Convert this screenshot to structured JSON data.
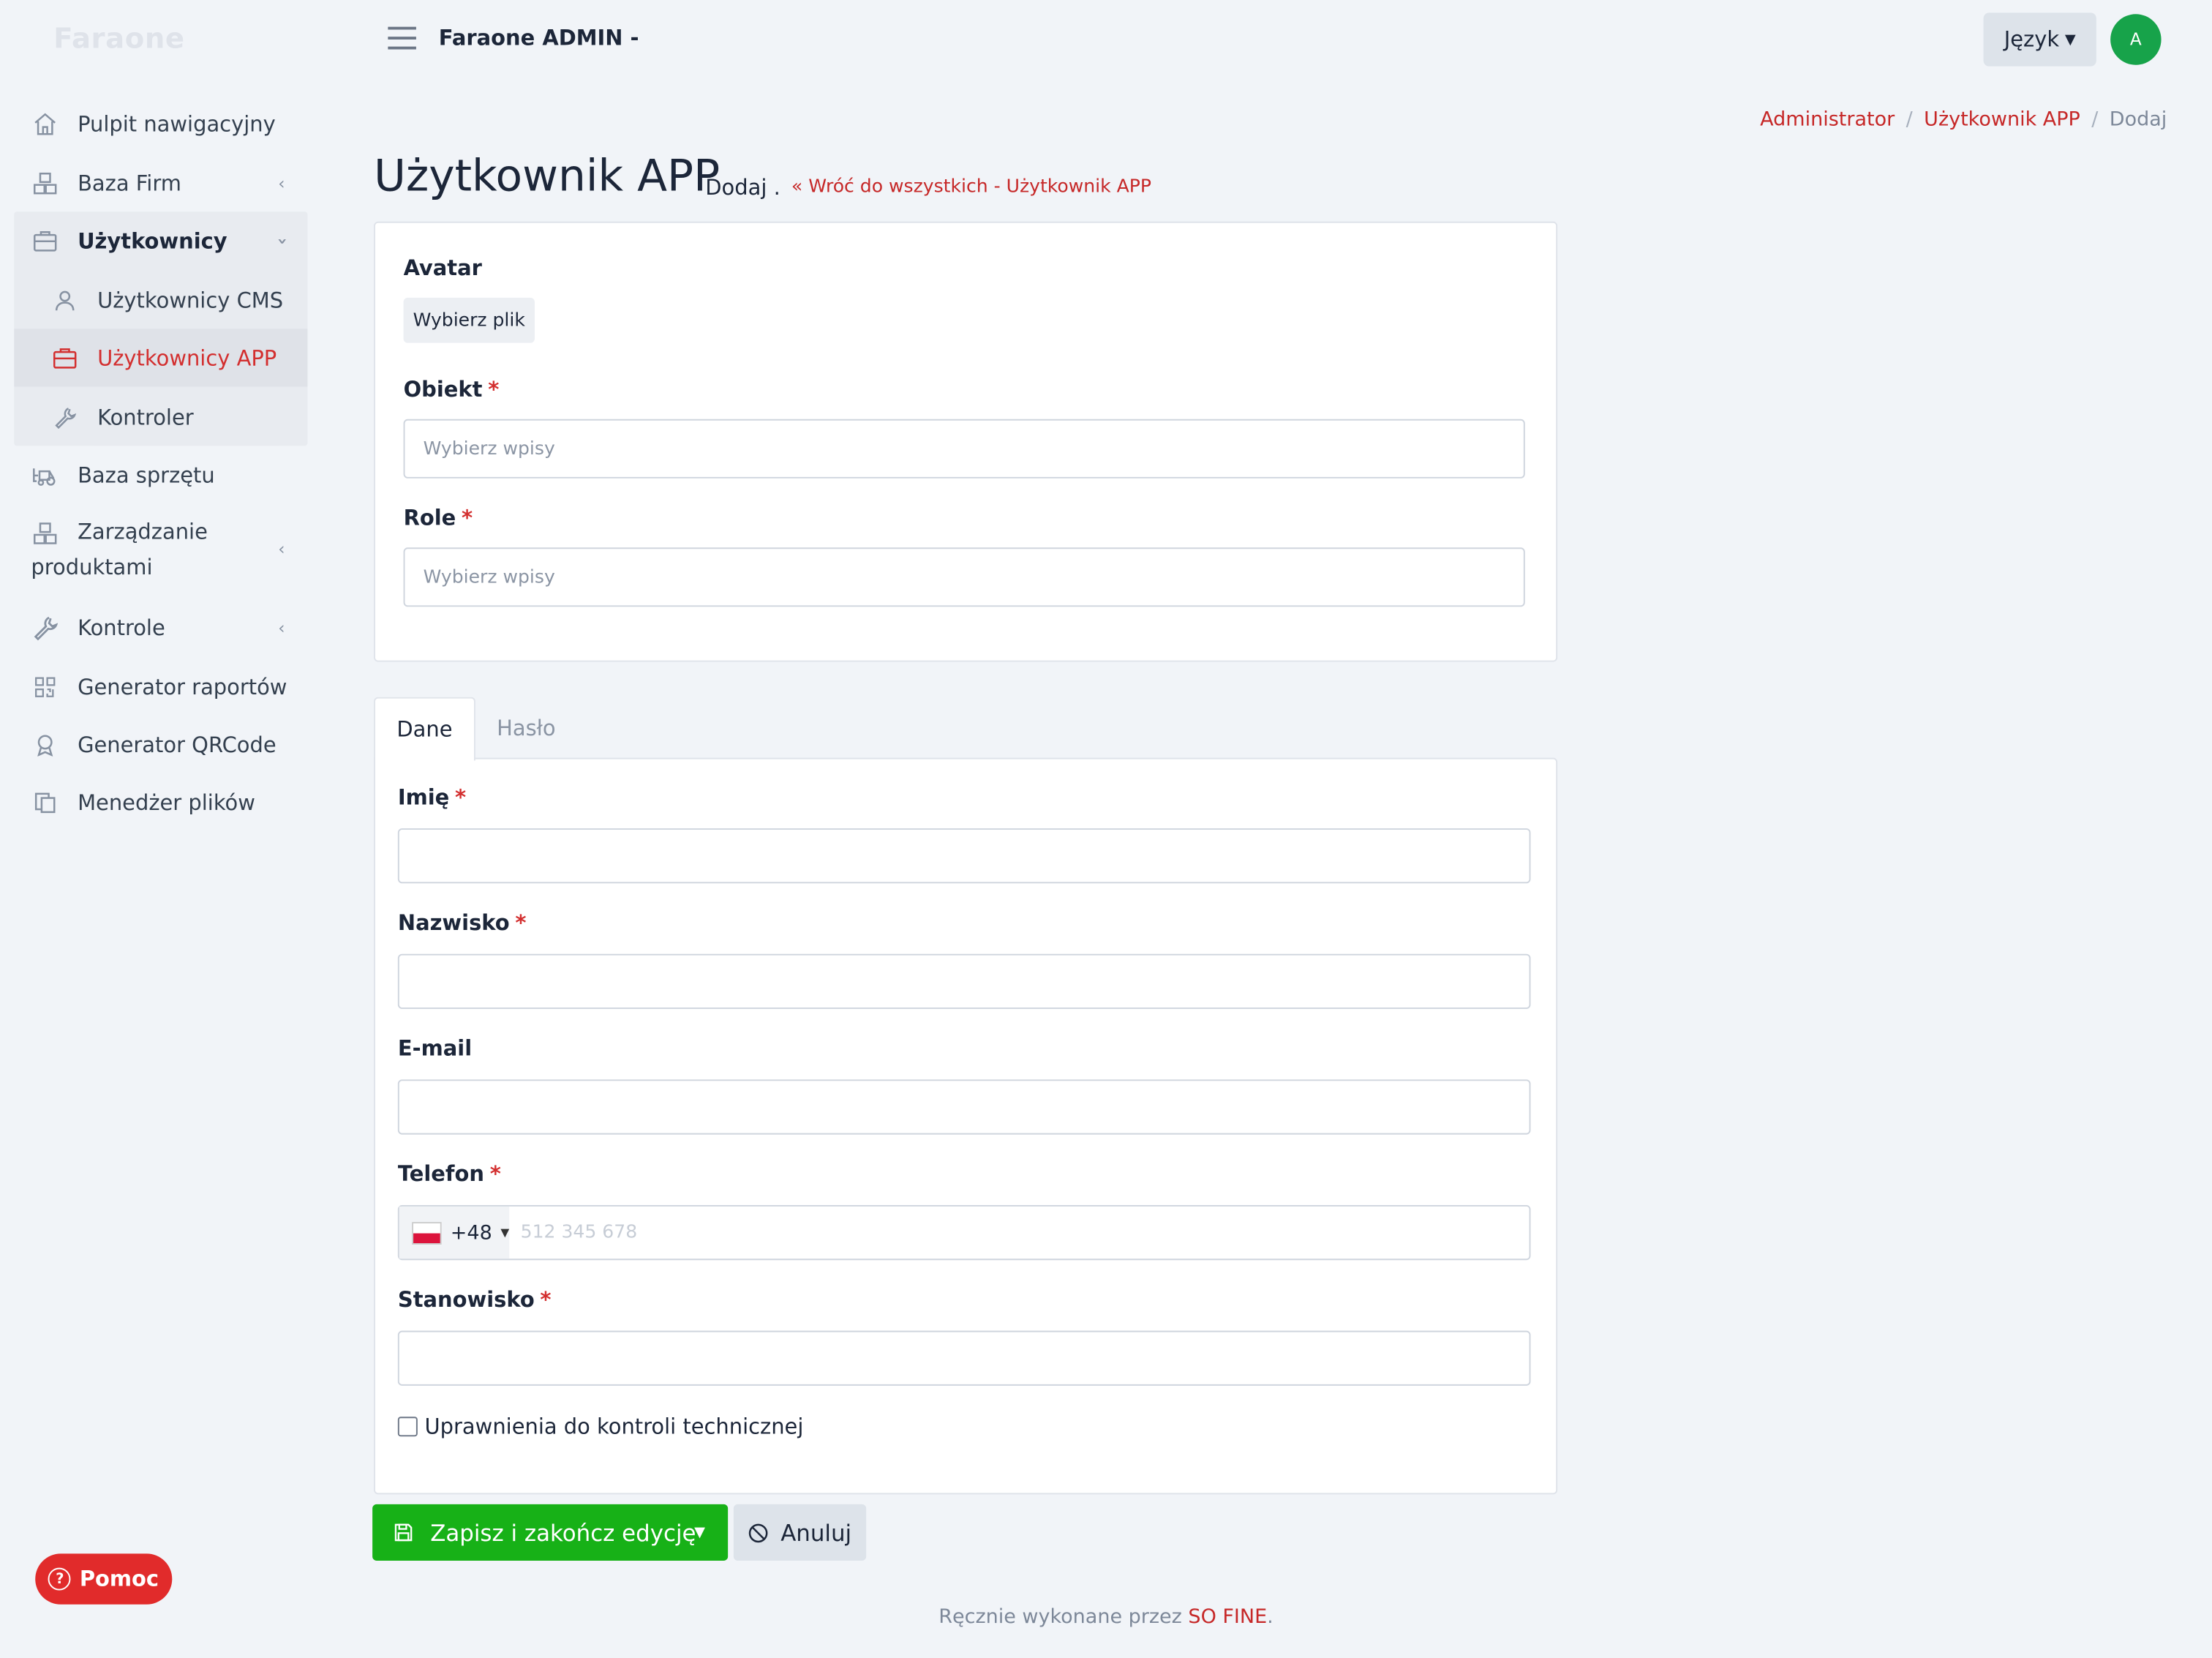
{
  "brand": "Faraone",
  "header": {
    "app_title": "Faraone ADMIN -",
    "language_label": "Język",
    "avatar_initial": "A",
    "avatar_color": "#17a34a"
  },
  "sidebar": {
    "items": [
      {
        "label": "Pulpit nawigacyjny",
        "icon": "home-icon"
      },
      {
        "label": "Baza Firm",
        "icon": "boxes-icon"
      },
      {
        "label": "Użytkownicy",
        "icon": "briefcase-icon"
      },
      {
        "label": "Użytkownicy CMS",
        "icon": "user-icon"
      },
      {
        "label": "Użytkownicy APP",
        "icon": "briefcase-icon"
      },
      {
        "label": "Kontroler",
        "icon": "wrench-icon"
      },
      {
        "label": "Baza sprzętu",
        "icon": "forklift-icon"
      },
      {
        "label": "Zarządzanie produktami",
        "icon": "boxes-icon"
      },
      {
        "label": "Kontrole",
        "icon": "wrench-icon"
      },
      {
        "label": "Generator raportów",
        "icon": "qr-icon"
      },
      {
        "label": "Generator QRCode",
        "icon": "award-icon"
      },
      {
        "label": "Menedżer plików",
        "icon": "files-icon"
      }
    ],
    "active_item": "Użytkownicy APP"
  },
  "breadcrumb": {
    "items": [
      "Administrator",
      "Użytkownik APP",
      "Dodaj"
    ]
  },
  "page": {
    "title": "Użytkownik APP",
    "subtitle": "Dodaj .",
    "back_link": "Wróć do wszystkich - Użytkownik APP"
  },
  "form_top": {
    "avatar_label": "Avatar",
    "file_button": "Wybierz plik",
    "object_label": "Obiekt",
    "object_placeholder": "Wybierz wpisy",
    "role_label": "Role",
    "role_placeholder": "Wybierz wpisy"
  },
  "tabs": [
    {
      "label": "Dane",
      "active": true
    },
    {
      "label": "Hasło",
      "active": false
    }
  ],
  "form_data": {
    "first_name_label": "Imię",
    "last_name_label": "Nazwisko",
    "email_label": "E-mail",
    "phone_label": "Telefon",
    "phone_country_code": "+48",
    "phone_placeholder": "512 345 678",
    "position_label": "Stanowisko",
    "checkbox_label": "Uprawnienia do kontroli technicznej",
    "required_mark": "*"
  },
  "actions": {
    "save_label": "Zapisz i zakończ edycję",
    "cancel_label": "Anuluj",
    "save_color": "#17b117"
  },
  "footer": {
    "text": "Ręcznie wykonane przez ",
    "brand": "SO FINE",
    "end": "."
  },
  "help": {
    "label": "Pomoc"
  },
  "colors": {
    "accent": "#c62828",
    "background": "#f1f4f8"
  }
}
